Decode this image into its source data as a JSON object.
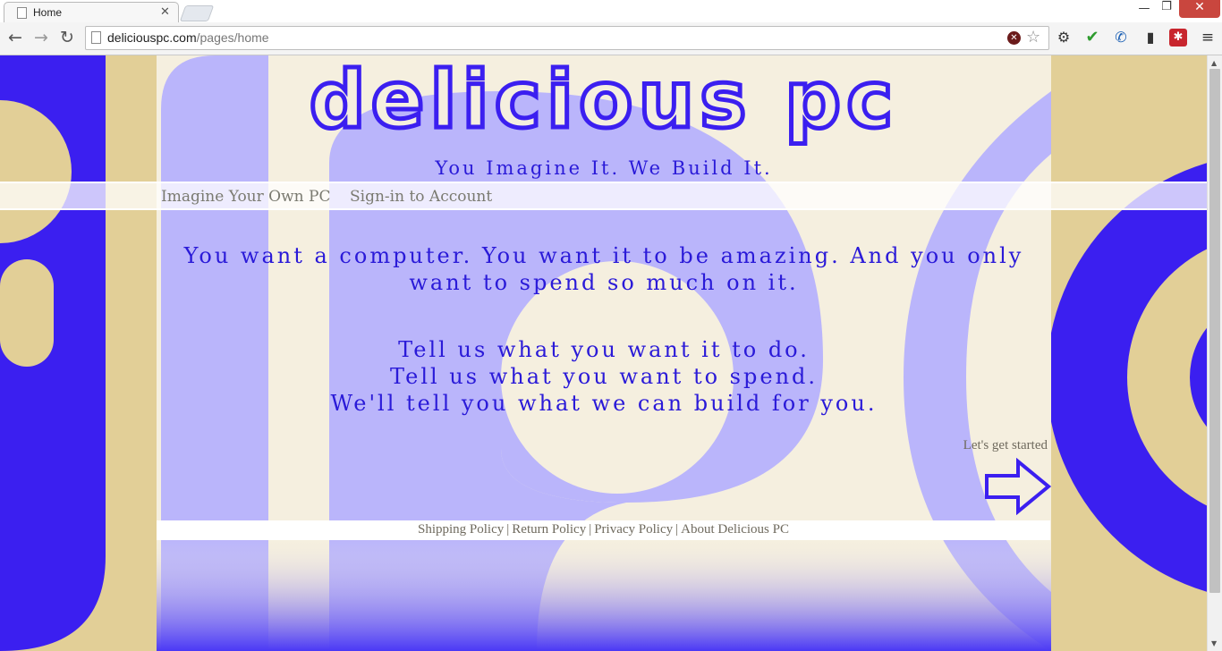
{
  "browser": {
    "tab_title": "Home",
    "tab_close": "✕",
    "url_host": "deliciouspc.com",
    "url_path": "/pages/home",
    "window_controls": {
      "minimize": "—",
      "maximize": "❐",
      "close": "✕"
    },
    "nav_icons": {
      "back": "←",
      "forward": "→",
      "reload": "↻"
    },
    "extension_icons": [
      "gear-icon",
      "checkmark-icon",
      "phone-icon",
      "device-icon",
      "red-extension-icon",
      "menu-icon"
    ]
  },
  "site": {
    "logo": "DELICIOUS PC",
    "tagline": "You Imagine It. We Build It.",
    "nav": [
      "Imagine Your Own PC",
      "Sign-in to Account"
    ],
    "intro": "You want a computer. You want it to be amazing. And you only want to spend so much on it.",
    "steps": [
      "Tell us what you want it to do.",
      "Tell us what you want to spend.",
      "We'll tell you what we can build for you."
    ],
    "cta_label": "Let's get started",
    "footer_links": [
      "Shipping Policy",
      "Return Policy",
      "Privacy Policy",
      "About Delicious PC"
    ],
    "footer_separator": "|"
  },
  "colors": {
    "brand_blue": "#3b1ff0",
    "light_blue": "#bab5fb",
    "tan": "#e2cf97",
    "cream": "#f5efdf"
  }
}
